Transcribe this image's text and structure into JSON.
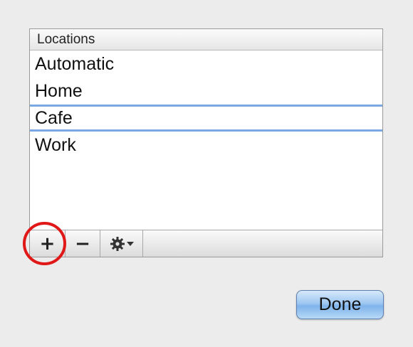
{
  "locations": {
    "header": "Locations",
    "items": [
      "Automatic",
      "Home",
      "Cafe",
      "Work"
    ],
    "selected": "Cafe"
  },
  "toolbar": {
    "add_label": "+",
    "remove_label": "−",
    "action_icon": "gear-icon",
    "action_menu_icon": "triangle-down-icon"
  },
  "annotation": {
    "highlight_color": "#e01818"
  },
  "done_button": {
    "label": "Done",
    "color": "#8fbdf0"
  },
  "colors": {
    "selection_border": "#7aa8e4",
    "window_background": "#ececec"
  }
}
